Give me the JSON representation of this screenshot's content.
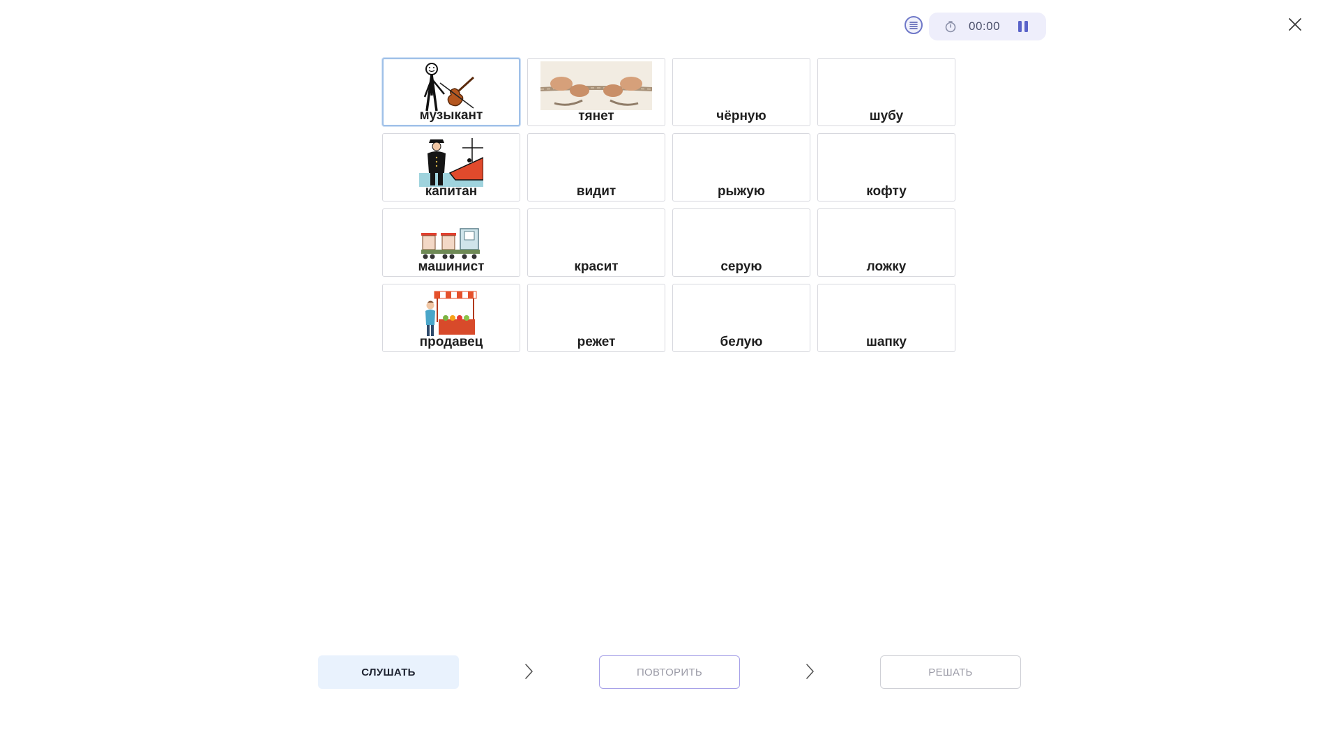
{
  "header": {
    "menu_icon": "list-icon",
    "timer": {
      "icon": "stopwatch-icon",
      "value": "00:00",
      "pause_icon": "pause-icon"
    },
    "close_icon": "close-icon"
  },
  "grid": {
    "cards": [
      {
        "label": "музыкант",
        "picture": "musician-with-violin",
        "selected": true
      },
      {
        "label": "тянет",
        "picture": "hands-pulling-rope"
      },
      {
        "label": "чёрную"
      },
      {
        "label": "шубу"
      },
      {
        "label": "капитан",
        "picture": "captain-on-ship"
      },
      {
        "label": "видит"
      },
      {
        "label": "рыжую"
      },
      {
        "label": "кофту"
      },
      {
        "label": "машинист",
        "picture": "toy-train"
      },
      {
        "label": "красит"
      },
      {
        "label": "серую"
      },
      {
        "label": "ложку"
      },
      {
        "label": "продавец",
        "picture": "seller-at-market-stall"
      },
      {
        "label": "режет"
      },
      {
        "label": "белую"
      },
      {
        "label": "шапку"
      }
    ]
  },
  "steps": {
    "listen": "СЛУШАТЬ",
    "repeat": "ПОВТОРИТЬ",
    "solve": "РЕШАТЬ",
    "separator_icon": "chevron-right-icon"
  },
  "colors": {
    "accent": "#6f78c8",
    "timer_bg": "#eeeefb",
    "listen_bg": "#e9f2fd",
    "repeat_border": "#a7a1e8",
    "selected_border": "#9fc0e8"
  }
}
